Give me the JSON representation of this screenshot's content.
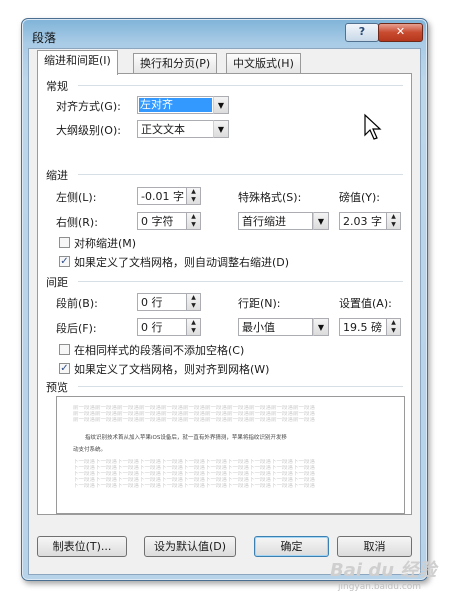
{
  "window": {
    "title": "段落",
    "help": "?",
    "close": "✕"
  },
  "tabs": [
    {
      "label": "缩进和间距(I)"
    },
    {
      "label": "换行和分页(P)"
    },
    {
      "label": "中文版式(H)"
    }
  ],
  "general": {
    "heading": "常规",
    "alignment_label": "对齐方式(G):",
    "alignment_value": "左对齐",
    "outline_label": "大纲级别(O):",
    "outline_value": "正文文本"
  },
  "indent": {
    "heading": "缩进",
    "left_label": "左侧(L):",
    "left_value": "-0.01 字",
    "right_label": "右侧(R):",
    "right_value": "0 字符",
    "special_label": "特殊格式(S):",
    "special_value": "首行缩进",
    "by_label": "磅值(Y):",
    "by_value": "2.03 字",
    "mirror_label": "对称缩进(M)",
    "mirror_checked": false,
    "auto_adjust_label": "如果定义了文档网格，则自动调整右缩进(D)",
    "auto_adjust_checked": true
  },
  "spacing": {
    "heading": "间距",
    "before_label": "段前(B):",
    "before_value": "0 行",
    "after_label": "段后(F):",
    "after_value": "0 行",
    "line_label": "行距(N):",
    "line_value": "最小值",
    "at_label": "设置值(A):",
    "at_value": "19.5 磅",
    "no_space_label": "在相同样式的段落间不添加空格(C)",
    "no_space_checked": false,
    "snap_grid_label": "如果定义了文档网格，则对齐到网格(W)",
    "snap_grid_checked": true
  },
  "preview": {
    "heading": "预览",
    "filler": "前一段落前一段落前一段落前一段落前一段落前一段落前一段落前一段落前一段落前一段落前一段落",
    "filler_after": "下一段落下一段落下一段落下一段落下一段落下一段落下一段落下一段落下一段落下一段落下一段落",
    "sample_line1": "指纹识别技术首从加入苹果iOS设备后，就一直有外界猜测，苹果将指纹识别开发移",
    "sample_line2": "动支付系统。"
  },
  "buttons": {
    "tabs": "制表位(T)...",
    "set_default": "设为默认值(D)",
    "ok": "确定",
    "cancel": "取消"
  },
  "watermark": {
    "main": "Bai du 经验",
    "url": "jingyan.baidu.com"
  }
}
